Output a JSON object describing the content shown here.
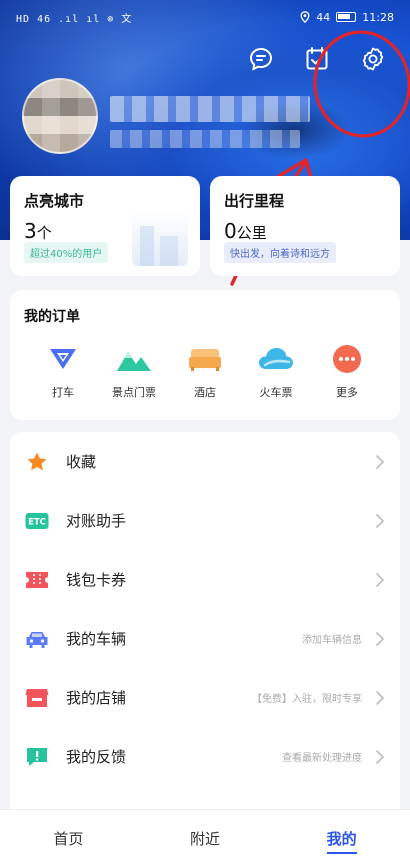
{
  "status_bar": {
    "left_text": "HD 46 .ıl ıl ⊚ 文",
    "battery_text": "44",
    "time": "11:28"
  },
  "top_icons": {
    "message": "message-icon",
    "checkin": "calendar-check-icon",
    "settings": "gear-icon"
  },
  "stats": [
    {
      "title": "点亮城市",
      "value": "3",
      "unit": "个",
      "note": "超过40%的用户"
    },
    {
      "title": "出行里程",
      "value": "0",
      "unit": "公里",
      "note": "快出发，向着诗和远方"
    }
  ],
  "orders": {
    "title": "我的订单",
    "items": [
      {
        "label": "打车",
        "icon": "taxi-icon",
        "color": "#4b6ef5"
      },
      {
        "label": "景点门票",
        "icon": "mountain-icon",
        "color": "#2dc7a2"
      },
      {
        "label": "酒店",
        "icon": "bed-icon",
        "color": "#f5a84b"
      },
      {
        "label": "火车票",
        "icon": "cloud-icon",
        "color": "#3fb6e8"
      },
      {
        "label": "更多",
        "icon": "more-icon",
        "color": "#f26a4f"
      }
    ]
  },
  "menu": [
    {
      "label": "收藏",
      "hint": "",
      "icon": "star-icon",
      "color": "#f58a25"
    },
    {
      "label": "对账助手",
      "hint": "",
      "icon": "etc-icon",
      "color": "#26c39c"
    },
    {
      "label": "钱包卡券",
      "hint": "",
      "icon": "ticket-icon",
      "color": "#f2545b"
    },
    {
      "label": "我的车辆",
      "hint": "添加车辆信息",
      "icon": "car-icon",
      "color": "#5b7cf2"
    },
    {
      "label": "我的店铺",
      "hint": "【免费】入驻，限时专享",
      "icon": "store-icon",
      "color": "#f2545b"
    },
    {
      "label": "我的反馈",
      "hint": "查看最新处理进度",
      "icon": "feedback-icon",
      "color": "#26c39c"
    }
  ],
  "tabs": [
    {
      "label": "首页",
      "active": false
    },
    {
      "label": "附近",
      "active": false
    },
    {
      "label": "我的",
      "active": true
    }
  ],
  "etc_text": "ETC"
}
